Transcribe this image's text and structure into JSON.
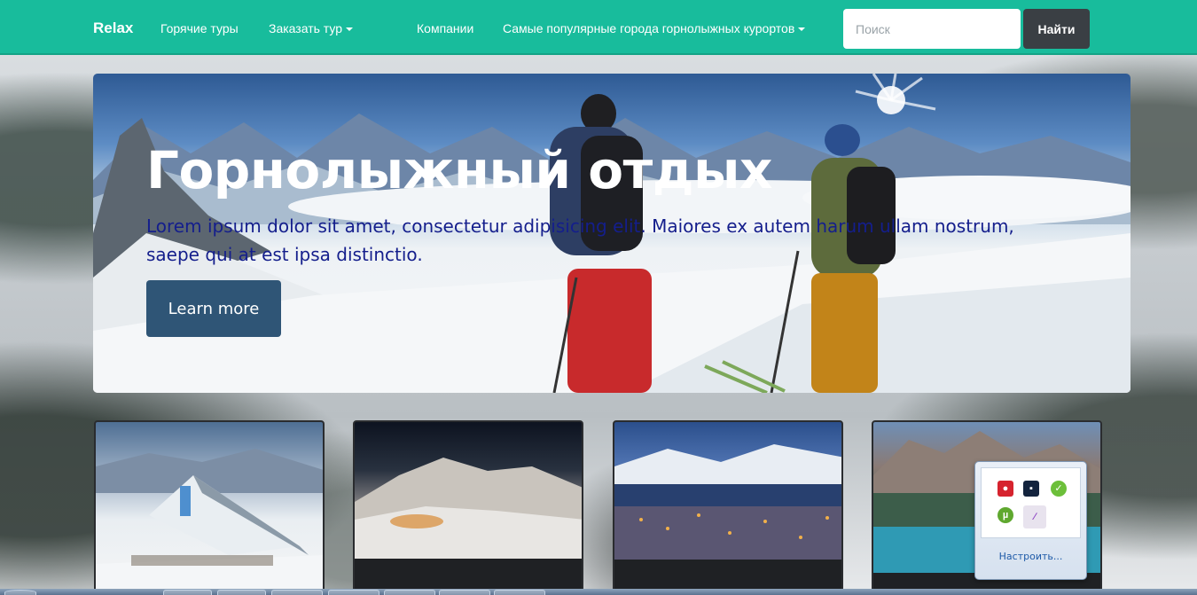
{
  "navbar": {
    "brand": "Relax",
    "links": [
      "Горячие туры",
      "Заказать тур",
      "Компании",
      "Самые популярные города горнолыжных курортов"
    ],
    "search_placeholder": "Поиск",
    "search_button": "Найти",
    "accent_color": "#18bc9c"
  },
  "hero": {
    "title": "Горнолыжный отдых",
    "text": "Lorem ipsum dolor sit amet, consectetur adipisicing elit. Maiores ex autem harum ullam nostrum, saepe qui at est ipsa distinctio.",
    "button": "Learn more",
    "button_color": "#2f5576"
  },
  "thumbnails": [
    "mountain-hotel",
    "night-mountain-village",
    "city-lights-fjord",
    "mountain-lake"
  ],
  "tray_popup": {
    "customize_link": "Настроить..."
  }
}
